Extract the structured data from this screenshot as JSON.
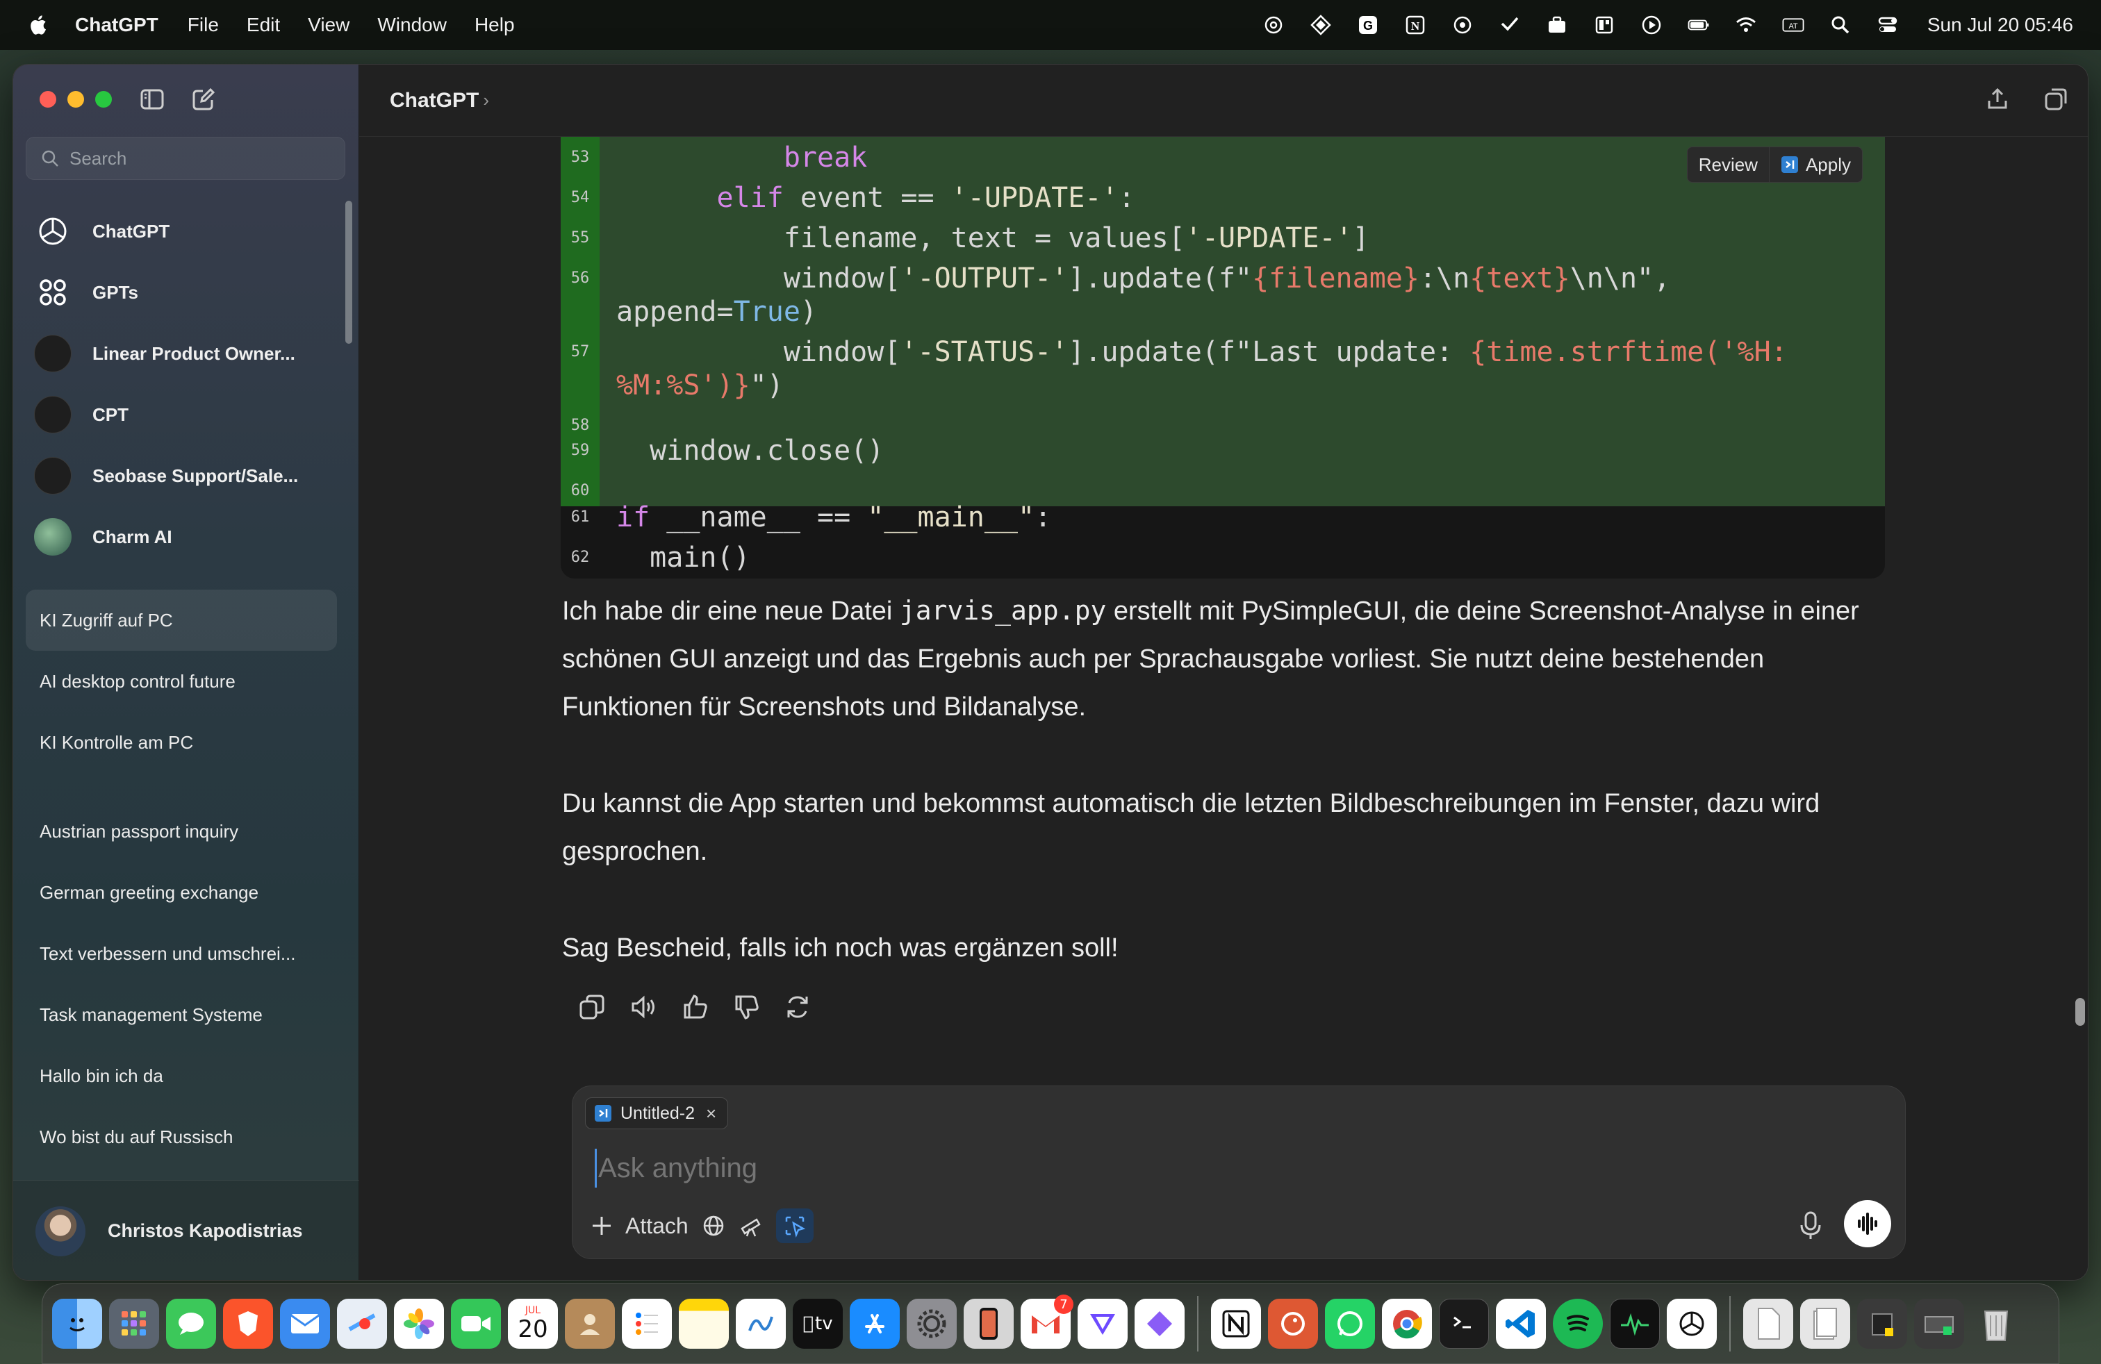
{
  "menubar": {
    "app_name": "ChatGPT",
    "menus": [
      "File",
      "Edit",
      "View",
      "Window",
      "Help"
    ],
    "keyboard_layout": "AT",
    "clock": "Sun Jul 20  05:46"
  },
  "sidebar": {
    "search_placeholder": "Search",
    "pinned": [
      {
        "label": "ChatGPT",
        "icon": "openai-logo-icon"
      },
      {
        "label": "GPTs",
        "icon": "grid-icon"
      },
      {
        "label": "Linear Product Owner...",
        "icon": "gpt-avatar"
      },
      {
        "label": "CPT",
        "icon": "gpt-avatar"
      },
      {
        "label": "Seobase Support/Sale...",
        "icon": "gpt-avatar"
      },
      {
        "label": "Charm AI",
        "icon": "gpt-avatar"
      }
    ],
    "history": [
      {
        "label": "KI Zugriff auf PC",
        "active": true
      },
      {
        "label": "AI desktop control future"
      },
      {
        "label": "KI Kontrolle am PC"
      },
      {
        "label": "Austrian passport inquiry"
      },
      {
        "label": "German greeting exchange"
      },
      {
        "label": "Text verbessern und umschrei..."
      },
      {
        "label": "Task management Systeme"
      },
      {
        "label": "Hallo bin ich da"
      },
      {
        "label": "Wo bist du auf Russisch"
      }
    ],
    "user_name": "Christos Kapodistrias"
  },
  "topbar": {
    "title": "ChatGPT",
    "chevron": "›"
  },
  "code": {
    "review_label": "Review",
    "apply_label": "Apply",
    "line_numbers": [
      "53",
      "54",
      "55",
      "56",
      "57",
      "58",
      "59",
      "60",
      "61",
      "62"
    ],
    "lines": {
      "l53_kw": "break",
      "l54_kw": "elif",
      "l54_a": " event == ",
      "l54_str": "'-UPDATE-'",
      "l54_b": ":",
      "l55_a": "filename, text = values[",
      "l55_str": "'-UPDATE-'",
      "l55_b": "]",
      "l56_a": "window[",
      "l56_str": "'-OUTPUT-'",
      "l56_b": "].update(f\"",
      "l56_f1": "{filename}",
      "l56_c": ":\\n",
      "l56_f2": "{text}",
      "l56_d": "\\n\\n\",",
      "l56w_a": "append=",
      "l56w_true": "True",
      "l56w_b": ")",
      "l57_a": "window[",
      "l57_str": "'-STATUS-'",
      "l57_b": "].update(f\"Last update: ",
      "l57_f": "{time.strftime('%H:",
      "l57w_f": "%M:%S')}",
      "l57w_b": "\")",
      "l59": "window.close()",
      "l61_kw": "if",
      "l61_a": " __name__ == ",
      "l61_str": "\"__main__\"",
      "l61_b": ":",
      "l62": "main()"
    }
  },
  "message": {
    "p1_before": "Ich habe dir eine neue Datei ",
    "p1_code": "jarvis_app.py",
    "p1_after": " erstellt mit PySimpleGUI, die deine Screenshot-Analyse in einer schönen GUI anzeigt und das Ergebnis auch per Sprachausgabe vorliest. Sie nutzt deine bestehenden Funktionen für Screenshots und Bildanalyse.",
    "p2": "Du kannst die App starten und bekommst automatisch die letzten Bildbeschreibungen im Fenster, dazu wird gesprochen.",
    "p3": "Sag Bescheid, falls ich noch was ergänzen soll!"
  },
  "composer": {
    "chip_label": "Untitled-2",
    "chip_close": "×",
    "placeholder": "Ask anything",
    "attach_label": "Attach"
  },
  "dock": {
    "calendar_month": "JUL",
    "calendar_day": "20",
    "mail_badge": "7",
    "tv_label": "tv"
  },
  "colors": {
    "accent": "#4a90e2",
    "code_highlight": "#2d4a2d",
    "code_gutter_highlight": "#1f6b1f",
    "keyword": "#d587e8",
    "fstring": "#e87a6a"
  }
}
